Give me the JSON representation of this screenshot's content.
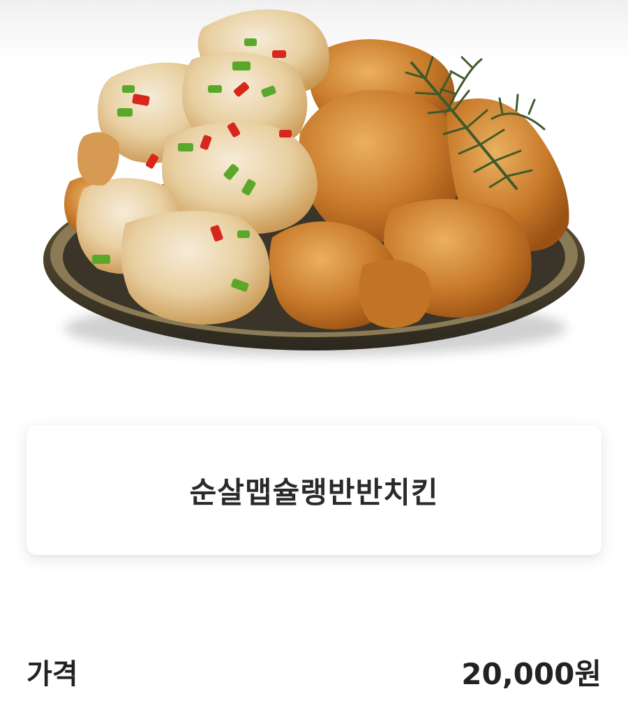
{
  "product": {
    "image_alt": "",
    "name": "순살맵슐랭반반치킨"
  },
  "price": {
    "label": "가격",
    "value": "20,000원"
  },
  "colors": {
    "plate": "#3a3528",
    "plate_rim": "#8a7a55",
    "chicken_dark": "#b8651c",
    "chicken_light": "#e0a050",
    "sauce": "#efe2c8",
    "pepper_red": "#d8261c",
    "pepper_green": "#5aa82a",
    "rosemary": "#3f5a2a"
  }
}
